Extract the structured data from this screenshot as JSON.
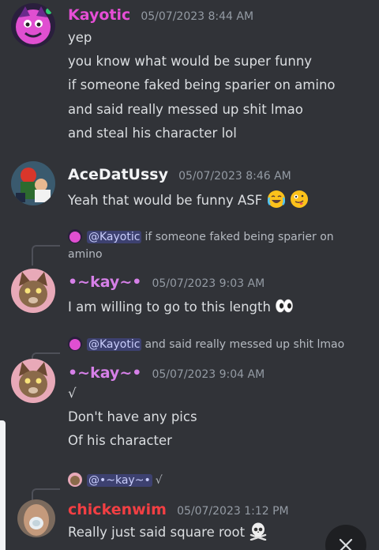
{
  "messages": [
    {
      "username": "Kayotic",
      "username_color": "#e64ed6",
      "timestamp": "05/07/2023 8:44 AM",
      "lines": [
        "yep",
        "you know what would be super funny",
        "if someone faked being sparier on amino",
        "and said really messed up shit lmao",
        "and steal his character lol"
      ]
    },
    {
      "username": "AceDatUssy",
      "username_color": "#f2f3f5",
      "timestamp": "05/07/2023 8:46 AM",
      "lines": [
        "Yeah that would be funny ASF"
      ],
      "emojis": [
        "joy-emoji",
        "zany-face-emoji"
      ]
    },
    {
      "reply": {
        "mention": "@Kayotic",
        "text": "if someone faked being sparier on",
        "text2": "amino"
      },
      "username": "•~kay~•",
      "username_color": "#d680e8",
      "timestamp": "05/07/2023 9:03 AM",
      "lines": [
        "I am willing to go to this length"
      ],
      "emojis": [
        "eyes-emoji"
      ]
    },
    {
      "reply": {
        "mention": "@Kayotic",
        "text": "and said really messed up shit lmao"
      },
      "username": "•~kay~•",
      "username_color": "#d680e8",
      "timestamp": "05/07/2023 9:04 AM",
      "lines": [
        "√",
        "Don't have any pics",
        "Of his character"
      ]
    },
    {
      "reply": {
        "mention": "@•~kay~•",
        "text": "√"
      },
      "username": "chickenwim",
      "username_color": "#f23f43",
      "timestamp": "05/07/2023 1:12 PM",
      "lines": [
        "Really just said square root"
      ],
      "emojis": [
        "skull-crossbones-emoji"
      ]
    }
  ],
  "close_button": {
    "icon": "close-icon"
  }
}
